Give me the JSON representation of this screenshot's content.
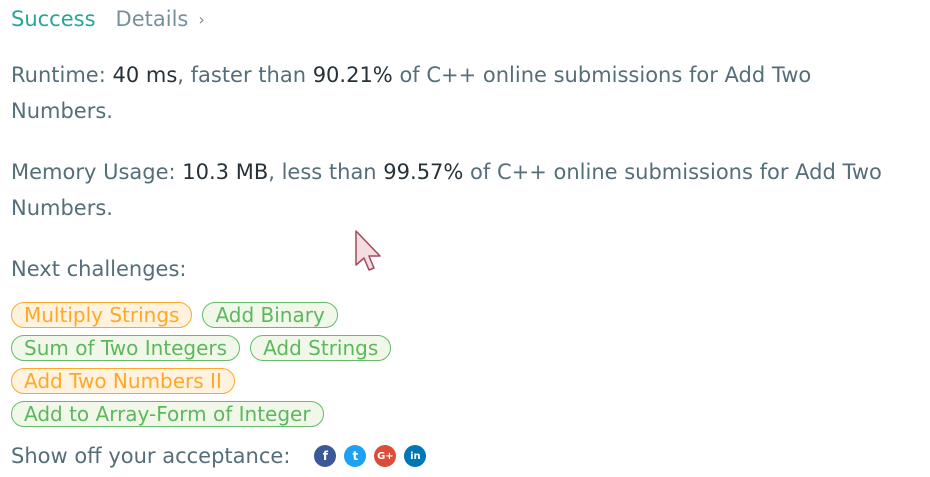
{
  "header": {
    "status": "Success",
    "details_label": "Details",
    "details_chevron": "›"
  },
  "runtime": {
    "label": "Runtime: ",
    "value": "40 ms",
    "mid": ", faster than ",
    "percent": "90.21%",
    "suffix": " of C++ online submissions for Add Two Numbers."
  },
  "memory": {
    "label": "Memory Usage: ",
    "value": "10.3 MB",
    "mid": ", less than ",
    "percent": "99.57%",
    "suffix": " of C++ online submissions for Add Two Numbers."
  },
  "next": {
    "title": "Next challenges:",
    "rows": [
      [
        {
          "label": "Multiply Strings",
          "difficulty": "medium"
        },
        {
          "label": "Add Binary",
          "difficulty": "easy"
        }
      ],
      [
        {
          "label": "Sum of Two Integers",
          "difficulty": "easy"
        },
        {
          "label": "Add Strings",
          "difficulty": "easy"
        }
      ],
      [
        {
          "label": "Add Two Numbers II",
          "difficulty": "medium"
        }
      ],
      [
        {
          "label": "Add to Array-Form of Integer",
          "difficulty": "easy"
        }
      ]
    ]
  },
  "share": {
    "label": "Show off your acceptance:",
    "icons": [
      {
        "name": "facebook-icon",
        "glyph": "f",
        "color": "#3b5998"
      },
      {
        "name": "twitter-icon",
        "glyph": "t",
        "color": "#1da1f2"
      },
      {
        "name": "google-plus-icon",
        "glyph": "G+",
        "color": "#dd4b39"
      },
      {
        "name": "linkedin-icon",
        "glyph": "in",
        "color": "#0077b5"
      }
    ]
  },
  "colors": {
    "success": "#26a69a",
    "medium": "#ffa726",
    "easy": "#5cb85c"
  }
}
